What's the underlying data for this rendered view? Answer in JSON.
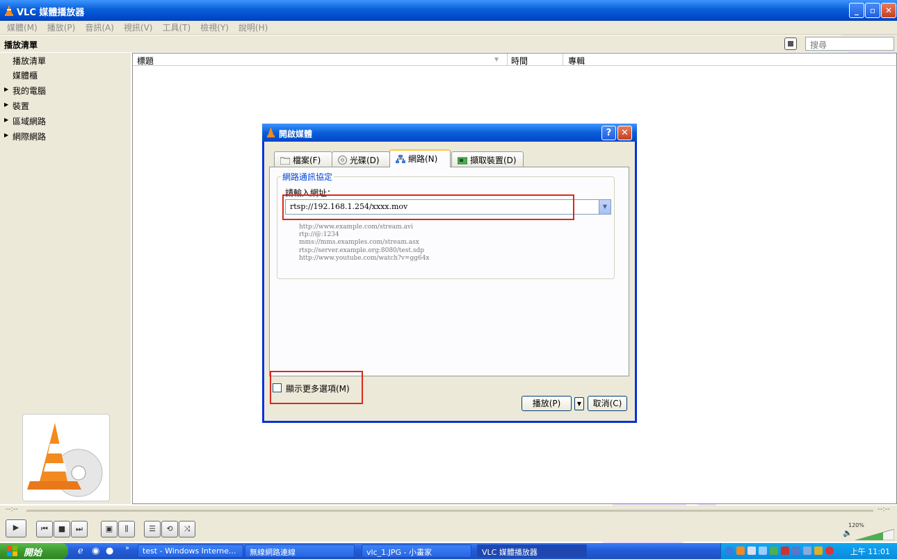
{
  "window": {
    "title": "VLC 媒體播放器",
    "buttons": [
      "_",
      "▫",
      "✕"
    ]
  },
  "menubar": [
    "媒體(M)",
    "播放(P)",
    "音訊(A)",
    "視訊(V)",
    "工具(T)",
    "檢視(Y)",
    "說明(H)"
  ],
  "playlist_header": {
    "label": "播放清單",
    "search_placeholder": "搜尋"
  },
  "sidebar": {
    "items": [
      "播放清單",
      "媒體櫃",
      "我的電腦",
      "裝置",
      "區域網路",
      "網際網路"
    ]
  },
  "columns": {
    "title": "標題",
    "time": "時間",
    "album": "專輯"
  },
  "seek": {
    "elapsed": "--:--",
    "total": "--:--"
  },
  "volume": {
    "percent_label": "120%"
  },
  "dialog": {
    "title": "開啟媒體",
    "help": "?",
    "close": "✕",
    "tabs": [
      "檔案(F)",
      "光碟(D)",
      "網路(N)",
      "擷取裝置(D)"
    ],
    "active_tab": 2,
    "group_title": "網路通訊協定",
    "url_label": "請輸入網址：",
    "url_value": "rtsp://192.168.1.254/xxxx.mov",
    "examples": [
      "http://www.example.com/stream.avi",
      "rtp://@:1234",
      "mms://mms.examples.com/stream.asx",
      "rtsp://server.example.org:8080/test.sdp",
      "http://www.youtube.com/watch?v=gg64x"
    ],
    "more_options": "顯示更多選項(M)",
    "play_button": "播放(P)",
    "cancel_button": "取消(C)"
  },
  "taskbar": {
    "start": "開始",
    "chevron": "»",
    "tasks": [
      "test - Windows Interne...",
      "無線網路連線",
      "vlc_1.JPG - 小畫家",
      "VLC 媒體播放器"
    ],
    "clock": "上午 11:01"
  },
  "colors": {
    "titlebar": "#0a5fd8",
    "highlight_box": "#d9281d",
    "watermark": "#8a00ff"
  }
}
